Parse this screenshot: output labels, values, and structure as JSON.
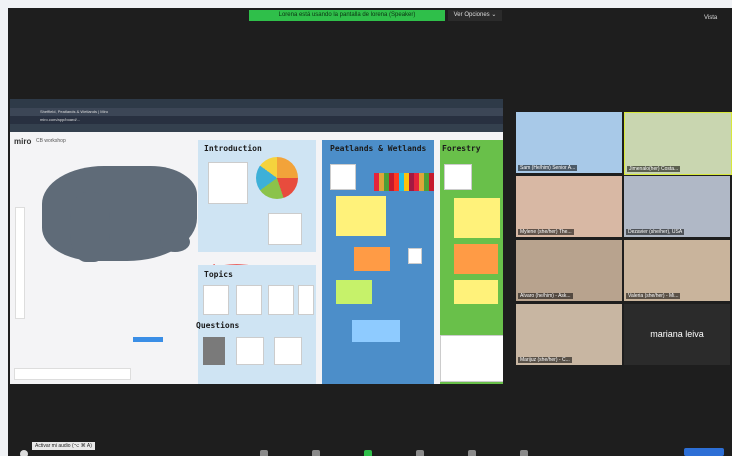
{
  "banner": {
    "text": "Lorena está usando la pantalla de lorena (Speaker)",
    "options": "Ver Opciones ⌄",
    "view": "Vista"
  },
  "browser": {
    "tab_title": "Sheffield, Peatlands & Wetlands | Miro",
    "url": "miro.com/app/board/..."
  },
  "miro": {
    "logo": "miro",
    "board_name": "CB workshop"
  },
  "frames": {
    "intro": "Introduction",
    "peat": "Peatlands & Wetlands",
    "forestry": "Forestry",
    "topics": "Topics",
    "questions": "Questions"
  },
  "participants": [
    {
      "label": "Sam (He/him) Senior A...",
      "bg": "#a8c9e8"
    },
    {
      "label": "Jimenalo(her) Costa...",
      "bg": "#c9d6b0"
    },
    {
      "label": "Mylene (she/her) The...",
      "bg": "#d8b8a4"
    },
    {
      "label": "Dezavier (she/her), USA",
      "bg": "#b0b8c6"
    },
    {
      "label": "Alvaro (he/him) - Ask...",
      "bg": "#b8a38e"
    },
    {
      "label": "Valeria (she/her) - Mi...",
      "bg": "#c9b49c"
    },
    {
      "label": "Marijuz (she/her) - C...",
      "bg": "#c8b6a2"
    },
    {
      "label": "mariana leiva",
      "bg": "#2b2b2b"
    }
  ],
  "tooltip": "Activar mi audio (⌥ ⌘ A)",
  "icons": [
    "shield-icon",
    "mic-icon",
    "video-icon",
    "participants-icon",
    "chat-icon",
    "share-icon",
    "record-icon",
    "reactions-icon"
  ]
}
